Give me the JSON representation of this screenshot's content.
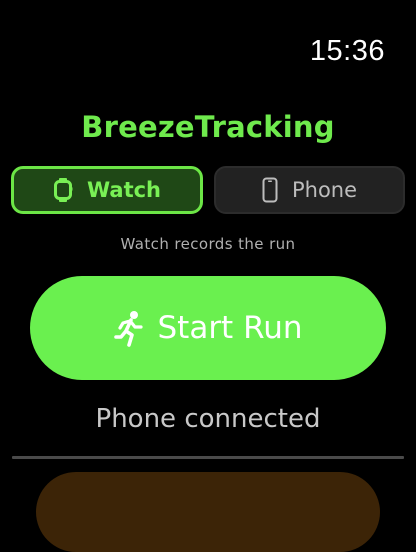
{
  "status_bar": {
    "time": "15:36"
  },
  "app": {
    "title": "BreezeTracking"
  },
  "source_selector": {
    "options": [
      {
        "label": "Watch",
        "icon": "watch-icon",
        "selected": true
      },
      {
        "label": "Phone",
        "icon": "phone-icon",
        "selected": false
      }
    ],
    "hint": "Watch records the run"
  },
  "start_button": {
    "label": "Start Run",
    "icon": "running-figure-icon"
  },
  "connection": {
    "status": "Phone connected"
  },
  "colors": {
    "accent_green": "#6af04f",
    "title_green": "#6fea4d",
    "selected_segment_bg": "#1f4816",
    "unselected_segment_bg": "#222222",
    "next_card_brown": "#3c2407",
    "background": "#000000"
  }
}
